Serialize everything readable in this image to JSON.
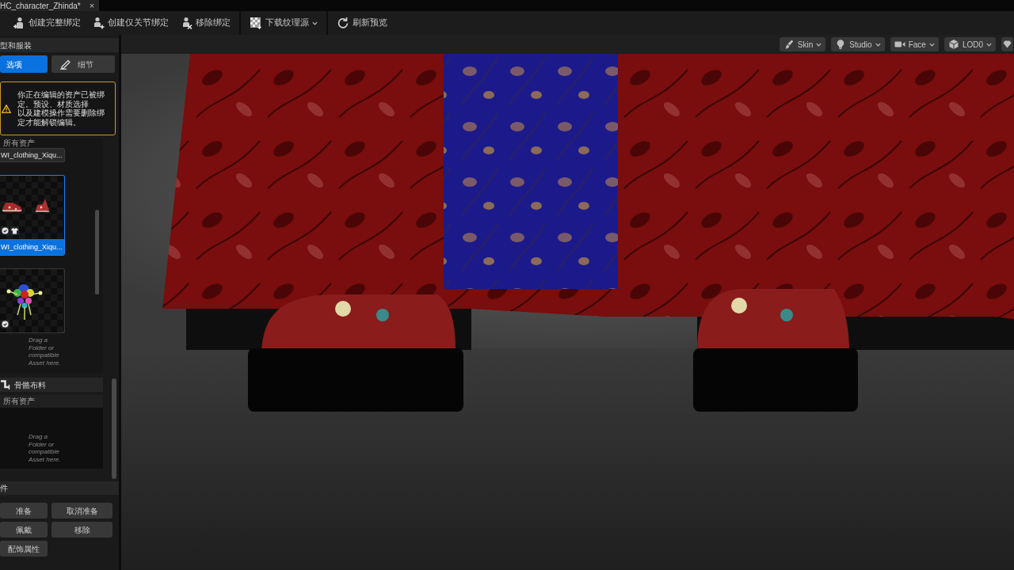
{
  "document_tab": {
    "title": "HC_character_Zhinda*",
    "close": "×"
  },
  "toolbar": [
    {
      "label": "创建完整绑定",
      "dropdown": false
    },
    {
      "label": "创建仅关节绑定",
      "dropdown": false
    },
    {
      "label": "移除绑定",
      "dropdown": false
    },
    {
      "label": "下载纹理源",
      "dropdown": true
    },
    {
      "label": "刷新预览",
      "dropdown": false
    }
  ],
  "panel": {
    "title": "型和服装",
    "tabs": [
      {
        "label": "选项",
        "selected": true
      },
      {
        "label": "细节",
        "selected": false
      }
    ],
    "warning": [
      "你正在编辑的资产已被绑定。预设、材质选择",
      "以及建模操作需要删除绑定才能解锁编辑。"
    ],
    "clothing": {
      "filter": "所有资产",
      "items": [
        {
          "kind": "label-only",
          "label": "WI_clothing_Xiqu...",
          "selected": false
        },
        {
          "kind": "outfit",
          "label": "WI_clothing_Xiqu...",
          "selected": true
        },
        {
          "kind": "accessory",
          "selected": false
        }
      ],
      "drop_hint": "Drag a Folder or compatible Asset here."
    },
    "cloth": {
      "title": "骨骼布料",
      "filter": "所有资产",
      "drop_hint": "Drag a Folder or compatible Asset here."
    },
    "accessories": {
      "title": "件",
      "buttons": [
        "准备",
        "取消准备",
        "佩戴",
        "移除",
        "配饰属性"
      ]
    }
  },
  "viewport": {
    "buttons": [
      {
        "label": "Skin"
      },
      {
        "label": "Studio"
      },
      {
        "label": "Face"
      },
      {
        "label": "LOD0"
      }
    ]
  }
}
